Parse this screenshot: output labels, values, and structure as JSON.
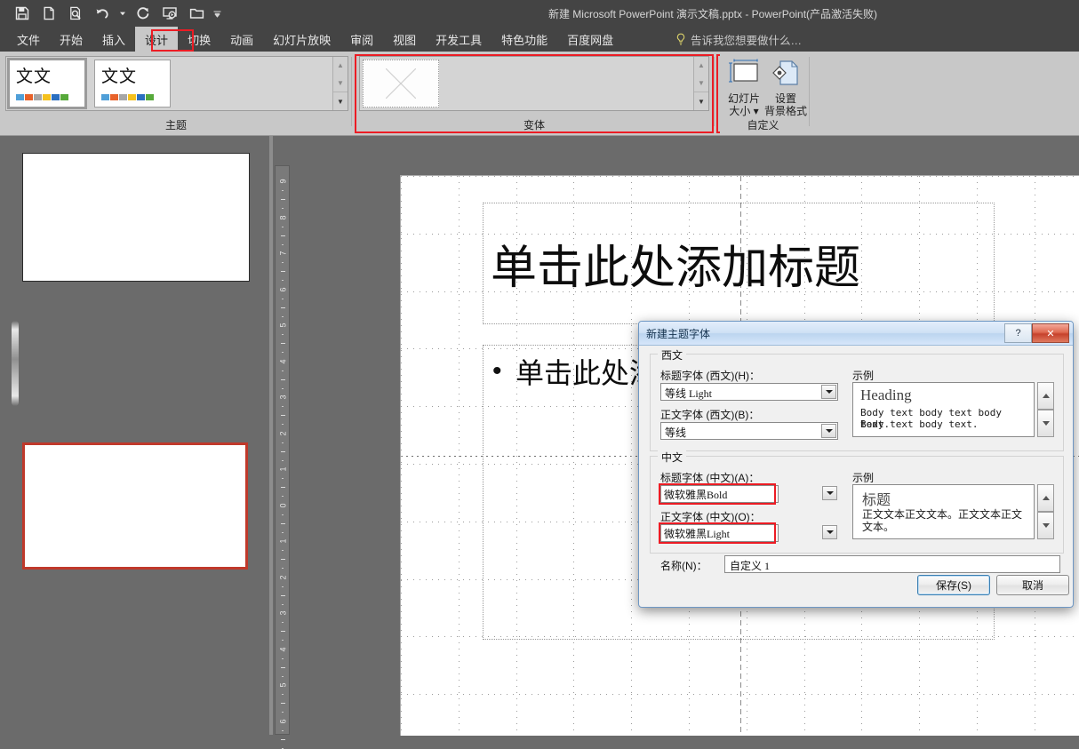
{
  "window": {
    "title": "新建 Microsoft PowerPoint 演示文稿.pptx - PowerPoint(产品激活失败)"
  },
  "quick_access": [
    {
      "name": "save-icon",
      "label": "保存"
    },
    {
      "name": "new-document-icon",
      "label": "新建"
    },
    {
      "name": "print-preview-icon",
      "label": "打印预览"
    },
    {
      "name": "undo-icon",
      "label": "撤消"
    },
    {
      "name": "redo-icon",
      "label": "恢复"
    },
    {
      "name": "start-slideshow-icon",
      "label": "从头开始"
    },
    {
      "name": "open-folder-icon",
      "label": "打开"
    },
    {
      "name": "customize-qat-icon",
      "label": "自定义快速访问工具栏"
    }
  ],
  "tabs": [
    {
      "label": "文件",
      "active": false
    },
    {
      "label": "开始",
      "active": false
    },
    {
      "label": "插入",
      "active": false
    },
    {
      "label": "设计",
      "active": true
    },
    {
      "label": "切换",
      "active": false
    },
    {
      "label": "动画",
      "active": false
    },
    {
      "label": "幻灯片放映",
      "active": false
    },
    {
      "label": "审阅",
      "active": false
    },
    {
      "label": "视图",
      "active": false
    },
    {
      "label": "开发工具",
      "active": false
    },
    {
      "label": "特色功能",
      "active": false
    },
    {
      "label": "百度网盘",
      "active": false
    }
  ],
  "tell_me": "告诉我您想要做什么…",
  "ribbon": {
    "groups": [
      {
        "name": "themes",
        "label": "主题"
      },
      {
        "name": "variants",
        "label": "变体"
      },
      {
        "name": "customize",
        "label": "自定义"
      }
    ],
    "theme_thumbnails": [
      {
        "text": "文文",
        "selected": true,
        "swatches": [
          "#4f9fd8",
          "#e8622a",
          "#a6a6a6",
          "#f5c11e",
          "#2b6fc0",
          "#56a93a"
        ]
      },
      {
        "text": "文文",
        "selected": false,
        "swatches": [
          "#4f9fd8",
          "#e8622a",
          "#a6a6a6",
          "#f5c11e",
          "#2b6fc0",
          "#56a93a"
        ]
      }
    ],
    "customize_buttons": [
      {
        "name": "slide-size-button",
        "line1": "幻灯片",
        "line2": "大小"
      },
      {
        "name": "format-background-button",
        "line1": "设置",
        "line2": "背景格式"
      }
    ]
  },
  "slide_pane": {
    "slides": [
      {
        "index": 1,
        "selected": false
      },
      {
        "index": 2,
        "selected": true
      }
    ]
  },
  "vertical_ruler": {
    "labels": [
      "9",
      "8",
      "7",
      "6",
      "5",
      "4",
      "3",
      "2",
      "1",
      "0",
      "1",
      "2",
      "3",
      "4",
      "5",
      "6"
    ]
  },
  "slide": {
    "title_placeholder": "单击此处添加标题",
    "body_placeholder": "单击此处添加文本",
    "bullet": "•"
  },
  "dialog": {
    "title": "新建主题字体",
    "help_button": "?",
    "close_button": "✕",
    "latin": {
      "legend": "西文",
      "heading_label": "标题字体 (西文)(H)：",
      "heading_value": "等线 Light",
      "body_label": "正文字体 (西文)(B)：",
      "body_value": "等线",
      "sample_label": "示例",
      "sample_heading": "Heading",
      "sample_body_line1": "Body text body text body text.",
      "sample_body_line2": "Body text body text."
    },
    "chinese": {
      "legend": "中文",
      "heading_label": "标题字体 (中文)(A)：",
      "heading_value": "微软雅黑Bold",
      "body_label": "正文字体 (中文)(O)：",
      "body_value": "微软雅黑Light",
      "sample_label": "示例",
      "sample_heading": "标题",
      "sample_body": "正文文本正文文本。正文文本正文文本。"
    },
    "name_label": "名称(N)：",
    "name_value": "自定义 1",
    "save_button": "保存(S)",
    "cancel_button": "取消"
  },
  "colors": {
    "titlebar_bg": "#444444",
    "ribbon_bg": "#c8c8c8",
    "workspace_bg": "#6b6b6b",
    "highlight_red": "#ec1c24",
    "selected_slide_border": "#c0392b",
    "dialog_bg": "#f0f0f0",
    "dialog_title_blue": "#cfe1f5"
  }
}
